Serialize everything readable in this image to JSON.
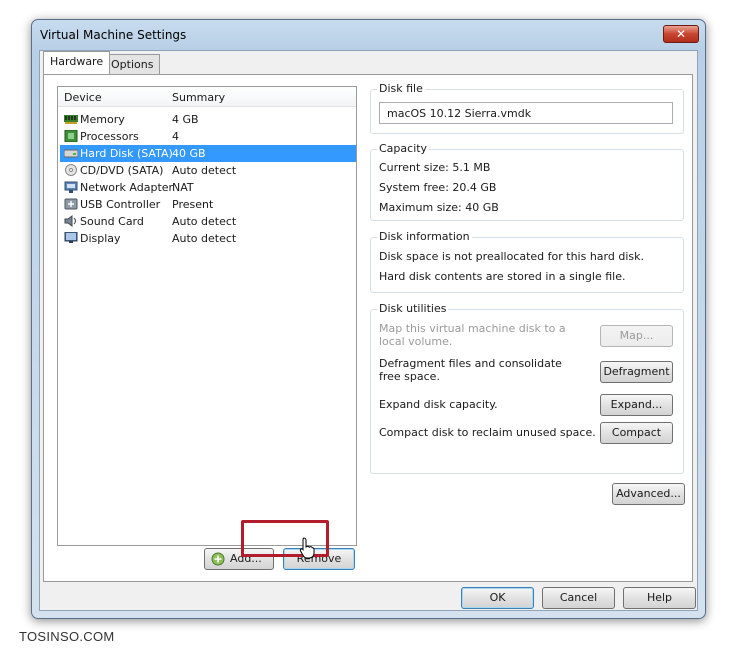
{
  "window": {
    "title": "Virtual Machine Settings",
    "close_glyph": "✕"
  },
  "tabs": [
    {
      "label": "Hardware",
      "active": true
    },
    {
      "label": "Options",
      "active": false
    }
  ],
  "device_list": {
    "columns": [
      "Device",
      "Summary"
    ],
    "rows": [
      {
        "device": "Memory",
        "summary": "4 GB",
        "icon": "memory-icon"
      },
      {
        "device": "Processors",
        "summary": "4",
        "icon": "processor-icon"
      },
      {
        "device": "Hard Disk (SATA)",
        "summary": "40 GB",
        "icon": "hard-disk-icon",
        "selected": true
      },
      {
        "device": "CD/DVD (SATA)",
        "summary": "Auto detect",
        "icon": "cd-dvd-icon"
      },
      {
        "device": "Network Adapter",
        "summary": "NAT",
        "icon": "network-adapter-icon"
      },
      {
        "device": "USB Controller",
        "summary": "Present",
        "icon": "usb-controller-icon"
      },
      {
        "device": "Sound Card",
        "summary": "Auto detect",
        "icon": "sound-card-icon"
      },
      {
        "device": "Display",
        "summary": "Auto detect",
        "icon": "display-icon"
      }
    ],
    "add_label": "Add...",
    "remove_label": "Remove"
  },
  "disk_file": {
    "title": "Disk file",
    "value": "macOS 10.12 Sierra.vmdk"
  },
  "capacity": {
    "title": "Capacity",
    "current_size": "Current size:  5.1 MB",
    "system_free": "System free:  20.4 GB",
    "maximum_size": "Maximum size:  40 GB"
  },
  "disk_information": {
    "title": "Disk information",
    "line1": "Disk space is not preallocated for this hard disk.",
    "line2": "Hard disk contents are stored in a single file."
  },
  "disk_utilities": {
    "title": "Disk utilities",
    "map_text": "Map this virtual machine disk to a local volume.",
    "map_button": "Map...",
    "defrag_text": "Defragment files and consolidate free space.",
    "defrag_button": "Defragment",
    "expand_text": "Expand disk capacity.",
    "expand_button": "Expand...",
    "compact_text": "Compact disk to reclaim unused space.",
    "compact_button": "Compact"
  },
  "advanced_button": "Advanced...",
  "footer": {
    "ok": "OK",
    "cancel": "Cancel",
    "help": "Help"
  },
  "watermark": "TOSINSO.COM",
  "colors": {
    "selection": "#3399ff",
    "highlight_frame": "#b11d2a",
    "title_gradient": "#c8dcef"
  }
}
